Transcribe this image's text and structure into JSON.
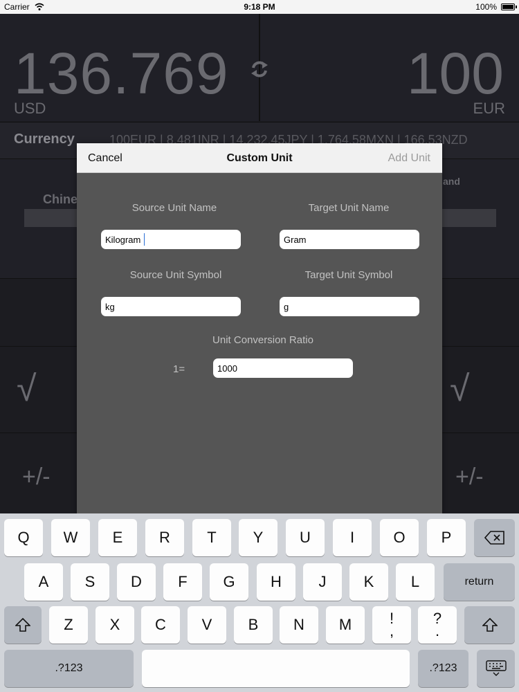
{
  "status_bar": {
    "carrier": "Carrier",
    "time": "9:18 PM",
    "battery": "100%"
  },
  "converter": {
    "source_value": "136.769",
    "source_code": "USD",
    "target_value": "100",
    "target_code": "EUR",
    "ticker_label": "Currency",
    "ticker_text": "100EUR  |  8,481INR  |  14,232.45JPY  |  1,764.58MXN  |  166.53NZD",
    "background_label_left": "Chine",
    "background_label_right": "and",
    "sqrt_symbol": "√",
    "plus_minus": "+/-"
  },
  "modal": {
    "cancel": "Cancel",
    "title": "Custom Unit",
    "add": "Add Unit",
    "source_name_label": "Source Unit Name",
    "target_name_label": "Target Unit Name",
    "source_symbol_label": "Source Unit Symbol",
    "target_symbol_label": "Target Unit Symbol",
    "ratio_label": "Unit Conversion Ratio",
    "ratio_prefix": "1=",
    "source_name_value": "Kilogram",
    "target_name_value": "Gram",
    "source_symbol_value": "kg",
    "target_symbol_value": "g",
    "ratio_value": "1000"
  },
  "keyboard": {
    "row1": [
      "Q",
      "W",
      "E",
      "R",
      "T",
      "Y",
      "U",
      "I",
      "O",
      "P"
    ],
    "row2": [
      "A",
      "S",
      "D",
      "F",
      "G",
      "H",
      "J",
      "K",
      "L"
    ],
    "row3": [
      "Z",
      "X",
      "C",
      "V",
      "B",
      "N",
      "M"
    ],
    "return": "return",
    "numbers": ".?123",
    "punct1_top": "!",
    "punct1_bottom": ",",
    "punct2_top": "?",
    "punct2_bottom": "."
  }
}
